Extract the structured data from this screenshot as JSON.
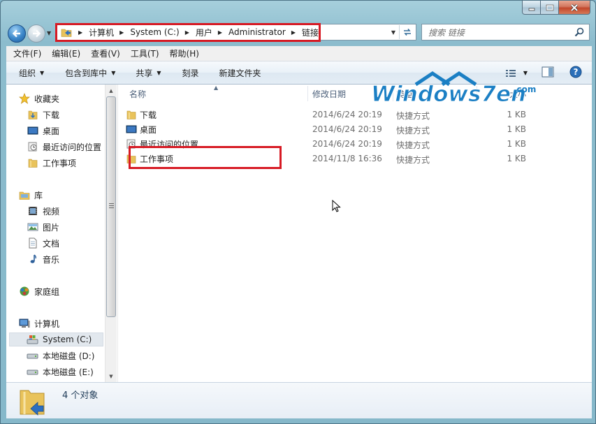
{
  "window": {
    "min_icon": "minimize-icon",
    "max_icon": "maximize-icon",
    "close_icon": "close-icon"
  },
  "address": {
    "crumbs": [
      "计算机",
      "System (C:)",
      "用户",
      "Administrator",
      "链接"
    ],
    "folder_icon": "links-folder-icon"
  },
  "search": {
    "placeholder": "搜索 链接"
  },
  "menu": [
    "文件(F)",
    "编辑(E)",
    "查看(V)",
    "工具(T)",
    "帮助(H)"
  ],
  "toolbar": {
    "organize": "组织",
    "include_in_library": "包含到库中",
    "share": "共享",
    "burn": "刻录",
    "new_folder": "新建文件夹"
  },
  "nav": {
    "favorites_label": "收藏夹",
    "favorites": [
      "下载",
      "桌面",
      "最近访问的位置",
      "工作事项"
    ],
    "libraries_label": "库",
    "libraries": [
      "视频",
      "图片",
      "文档",
      "音乐"
    ],
    "homegroup": "家庭组",
    "computer_label": "计算机",
    "drives": [
      "System (C:)",
      "本地磁盘 (D:)",
      "本地磁盘 (E:)"
    ]
  },
  "columns": {
    "name": "名称",
    "date": "修改日期",
    "type": "类型",
    "size": "大小"
  },
  "files": [
    {
      "name": "下载",
      "date": "2014/6/24 20:19",
      "type": "快捷方式",
      "size": "1 KB",
      "icon": "folder-icon"
    },
    {
      "name": "桌面",
      "date": "2014/6/24 20:19",
      "type": "快捷方式",
      "size": "1 KB",
      "icon": "desktop-icon"
    },
    {
      "name": "最近访问的位置",
      "date": "2014/6/24 20:19",
      "type": "快捷方式",
      "size": "1 KB",
      "icon": "recent-places-icon"
    },
    {
      "name": "工作事项",
      "date": "2014/11/8 16:36",
      "type": "快捷方式",
      "size": "1 KB",
      "icon": "folder-icon"
    }
  ],
  "status": {
    "count": "4 个对象"
  },
  "watermark": {
    "text": "Windows7en",
    "suffix": ".com"
  },
  "colors": {
    "highlight_red": "#d71a24",
    "watermark_blue": "#1b7fc4"
  }
}
